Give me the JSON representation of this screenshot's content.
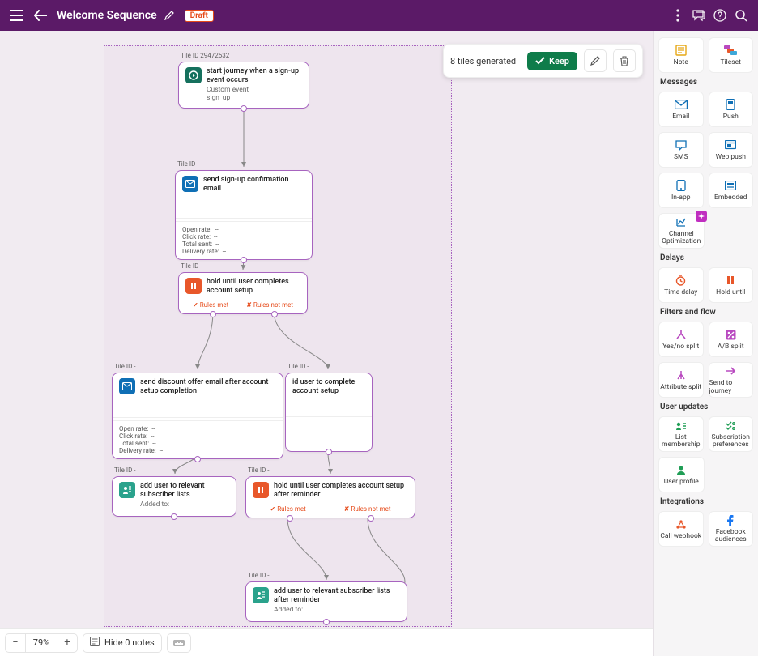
{
  "header": {
    "title": "Welcome Sequence",
    "badge": "Draft"
  },
  "floatbar": {
    "status": "8 tiles generated",
    "keep": "Keep"
  },
  "palette": {
    "top": [
      {
        "label": "Note"
      },
      {
        "label": "Tileset"
      }
    ],
    "sections": [
      {
        "title": "Messages",
        "items": [
          {
            "label": "Email"
          },
          {
            "label": "Push"
          },
          {
            "label": "SMS"
          },
          {
            "label": "Web push"
          },
          {
            "label": "In-app"
          },
          {
            "label": "Embedded"
          },
          {
            "label": "Channel Optimization"
          }
        ]
      },
      {
        "title": "Delays",
        "items": [
          {
            "label": "Time delay"
          },
          {
            "label": "Hold until"
          }
        ]
      },
      {
        "title": "Filters and flow",
        "items": [
          {
            "label": "Yes/no split"
          },
          {
            "label": "A/B split"
          },
          {
            "label": "Attribute split"
          },
          {
            "label": "Send to journey"
          }
        ]
      },
      {
        "title": "User updates",
        "items": [
          {
            "label": "List membership"
          },
          {
            "label": "Subscription preferences"
          },
          {
            "label": "User profile"
          }
        ]
      },
      {
        "title": "Integrations",
        "items": [
          {
            "label": "Call webhook"
          },
          {
            "label": "Facebook audiences"
          }
        ]
      }
    ]
  },
  "tiles": {
    "t1": {
      "idlabel": "Tile ID 29472632",
      "title": "start journey when a sign-up event occurs",
      "sub1": "Custom event",
      "sub2": "sign_up"
    },
    "t2": {
      "idlabel": "Tile ID -",
      "title": "send sign-up confirmation email",
      "stats": {
        "open": "Open rate:",
        "openv": "--",
        "click": "Click rate:",
        "clickv": "--",
        "sent": "Total sent:",
        "sentv": "--",
        "deliv": "Delivery rate:",
        "delivv": "--"
      }
    },
    "t3": {
      "idlabel": "Tile ID -",
      "title": "hold until user completes account setup",
      "rmet": "Rules met",
      "rnot": "Rules not met"
    },
    "t4": {
      "idlabel": "Tile ID -",
      "title": "send discount offer email after account setup completion",
      "stats": {
        "open": "Open rate:",
        "openv": "--",
        "click": "Click rate:",
        "clickv": "--",
        "sent": "Total sent:",
        "sentv": "--",
        "deliv": "Delivery rate:",
        "delivv": "--"
      }
    },
    "t5": {
      "idlabel": "Tile ID -",
      "title": "id user to complete account setup"
    },
    "t6": {
      "idlabel": "Tile ID -",
      "title": "add user to relevant subscriber lists",
      "sub": "Added to:"
    },
    "t7": {
      "idlabel": "Tile ID -",
      "title": "hold until user completes account setup after reminder",
      "rmet": "Rules met",
      "rnot": "Rules not met"
    },
    "t8": {
      "idlabel": "Tile ID -",
      "title": "add user to relevant subscriber lists after reminder",
      "sub": "Added to:"
    }
  },
  "bottom": {
    "zoom": "79%",
    "notes": "Hide 0 notes"
  }
}
